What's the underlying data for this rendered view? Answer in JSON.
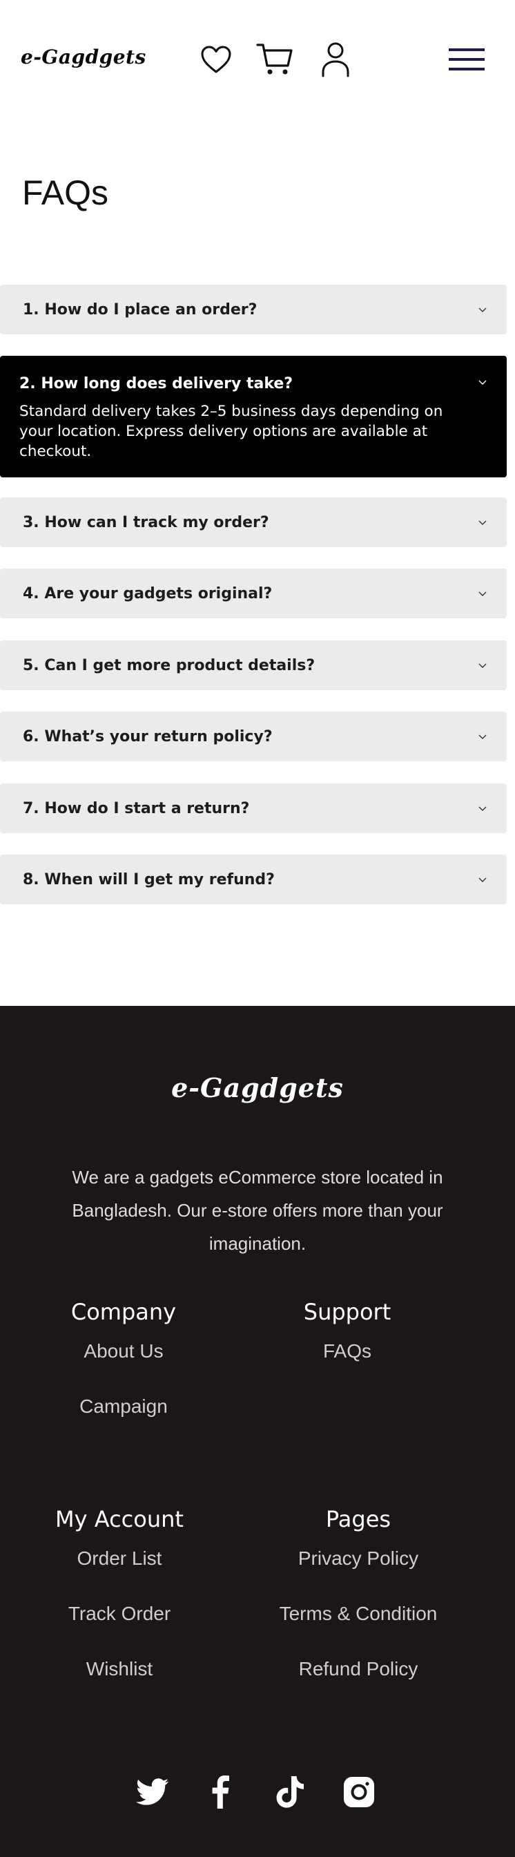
{
  "header": {
    "logo": "e-Gagdgets",
    "icons": [
      "heart-icon",
      "cart-icon",
      "user-icon",
      "menu-icon"
    ],
    "menu_color": "#1e1a4f"
  },
  "page_title": "FAQs",
  "faqs": [
    {
      "number": "1.",
      "question": "How do I place an order?",
      "open": false
    },
    {
      "number": "2.",
      "question": "How long does delivery take?",
      "open": true,
      "answer": "Standard delivery takes 2–5 business days depending on your location. Express delivery options are available at checkout."
    },
    {
      "number": "3.",
      "question": "How can I track my order?",
      "open": false
    },
    {
      "number": "4.",
      "question": "Are your gadgets original?",
      "open": false
    },
    {
      "number": "5.",
      "question": "Can I get more product details?",
      "open": false
    },
    {
      "number": "6.",
      "question": "What’s your return policy?",
      "open": false
    },
    {
      "number": "7.",
      "question": "How do I start a return?",
      "open": false
    },
    {
      "number": "8.",
      "question": "When will I get my refund?",
      "open": false
    }
  ],
  "footer": {
    "logo": "e-Gagdgets",
    "description": "We are a gadgets eCommerce store located in Bangladesh. Our e-store offers more than your imagination.",
    "company": {
      "heading": "Company",
      "links": [
        "About Us",
        "Campaign"
      ]
    },
    "support": {
      "heading": "Support",
      "links": [
        "FAQs"
      ]
    },
    "account": {
      "heading": "My Account",
      "links": [
        "Order List",
        "Track Order",
        "Wishlist"
      ]
    },
    "pages": {
      "heading": "Pages",
      "links": [
        "Privacy Policy",
        "Terms & Condition",
        "Refund Policy"
      ]
    },
    "social_icons": [
      "twitter-icon",
      "facebook-icon",
      "tiktok-icon",
      "instagram-icon"
    ],
    "background": "#1b1716"
  }
}
